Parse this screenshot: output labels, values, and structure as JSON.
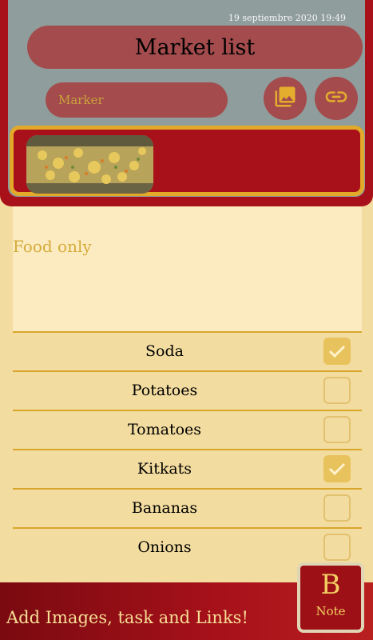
{
  "header": {
    "timestamp": "19 septiembre 2020 19:49",
    "title": "Market list",
    "marker_placeholder": "Marker",
    "image_button_icon": "image-icon",
    "link_button_icon": "link-icon"
  },
  "note": {
    "text": "Food only"
  },
  "checklist": [
    {
      "label": "Soda",
      "checked": true
    },
    {
      "label": "Potatoes",
      "checked": false
    },
    {
      "label": "Tomatoes",
      "checked": false
    },
    {
      "label": "Kitkats",
      "checked": true
    },
    {
      "label": "Bananas",
      "checked": false
    },
    {
      "label": "Onions",
      "checked": false
    }
  ],
  "banner": {
    "text": "Add Images, task and Links!",
    "logo_letter": "B",
    "logo_note": "Note"
  },
  "colors": {
    "primary": "#a8111a",
    "accent": "#e3a928",
    "background": "#f3dc9f"
  }
}
